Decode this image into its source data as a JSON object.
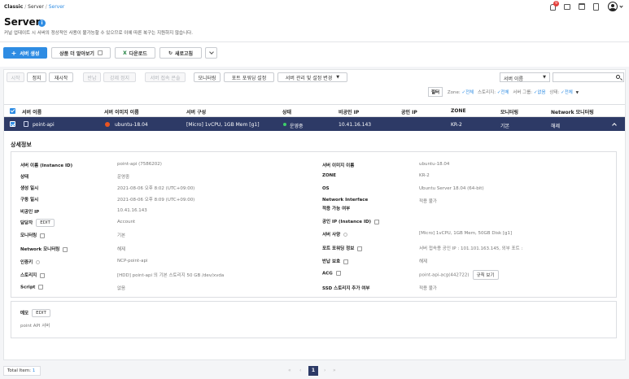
{
  "breadcrumb": {
    "root": "Classic",
    "sep": "/",
    "mid": "Server",
    "current": "Server"
  },
  "header_icons": {
    "notification_count": "9",
    "icons": [
      "bell-icon",
      "chat-icon",
      "calendar-icon",
      "doc-icon",
      "user-avatar-icon"
    ]
  },
  "page": {
    "title": "Server",
    "info_badge": "i",
    "description": "커널 업데이트 시 서버의 정상적인 사용이 불가능할 수 있으므로 이에 따른 복구는 지원하지 않습니다."
  },
  "toolbar": {
    "create": "서버 생성",
    "more_info": "상품 더 알아보기",
    "download": "다운로드",
    "refresh": "새로고침"
  },
  "actions": {
    "start": "시작",
    "stop": "정지",
    "restart": "재시작",
    "return": "반납",
    "force_stop": "강제 정지",
    "console": "서버 접속 콘솔",
    "monitoring": "모니터링",
    "port_forward": "포트 포워딩 설정",
    "manage": "서버 관리 및 설정 변경"
  },
  "search": {
    "select_value": "서버 이름",
    "placeholder": ""
  },
  "filter": {
    "label": "필터",
    "zone_label": "Zone:",
    "zone_val": "전체",
    "storage_label": "스토리지:",
    "storage_val": "전체",
    "group_label": "서버 그룹:",
    "group_val": "없음",
    "status_label": "상태:",
    "status_val": "전체"
  },
  "table": {
    "headers": [
      "서버 이름",
      "서버 이미지 이름",
      "서버 구성",
      "상태",
      "비공인 IP",
      "공인 IP",
      "ZONE",
      "모니터링",
      "Network 모니터링"
    ],
    "row": {
      "name": "point-api",
      "image": "ubuntu-18.04",
      "spec": "[Micro] 1vCPU, 1GB Mem [g1]",
      "status": "운영중",
      "private_ip": "10.41.16.143",
      "public_ip": "",
      "zone": "KR-2",
      "monitoring": "기본",
      "net_monitoring": "해제"
    }
  },
  "detail": {
    "title": "상세정보",
    "left": [
      {
        "label": "서버 이름 (Instance ID)",
        "value": "point-api (7586202)"
      },
      {
        "label": "상태",
        "value": "운영중"
      },
      {
        "label": "생성 일시",
        "value": "2021-08-06 오후 8:02 (UTC+09:00)"
      },
      {
        "label": "구동 일시",
        "value": "2021-08-06 오후 8:09 (UTC+09:00)"
      },
      {
        "label": "비공인 IP",
        "value": "10.41.16.143"
      },
      {
        "label": "담당자",
        "value": "Account",
        "edit": "EDIT"
      },
      {
        "label": "모니터링",
        "value": "기본"
      },
      {
        "label": "Network 모니터링",
        "value": "해제"
      },
      {
        "label": "인증키",
        "value": "NCP-point-api"
      },
      {
        "label": "스토리지",
        "value": "[HDD] point-api 의 기본 스토리지  50 GB /dev/xvda"
      },
      {
        "label": "Script",
        "value": "없음"
      }
    ],
    "right": [
      {
        "label": "서버 이미지 이름",
        "value": "ubuntu-18.04"
      },
      {
        "label": "ZONE",
        "value": "KR-2"
      },
      {
        "label": "OS",
        "value": "Ubuntu Server 18.04 (64-bit)"
      },
      {
        "label": "Network Interface",
        "label2": "적용 가능 여부",
        "value": "적용 불가"
      },
      {
        "label": "공인 IP (Instance ID)",
        "value": ""
      },
      {
        "label": "서버 사양",
        "value": "[Micro] 1vCPU, 1GB Mem, 50GB Disk [g1]"
      },
      {
        "label": "포트 포워딩 정보",
        "value": "서버 접속용 공인 IP : 101.101.163.145, 외부 포트 :"
      },
      {
        "label": "반납 보호",
        "value": "해제"
      },
      {
        "label": "ACG",
        "value": "point-api-acg(442722)",
        "btn": "규칙 보기"
      },
      {
        "label": "SSD 스토리지 추가 여부",
        "value": "적용 불가"
      }
    ],
    "memo": {
      "label": "메모",
      "edit": "EDIT",
      "value": "point API 서버"
    }
  },
  "footer": {
    "total_label": "Total Item:",
    "total": "1",
    "page": "1"
  }
}
